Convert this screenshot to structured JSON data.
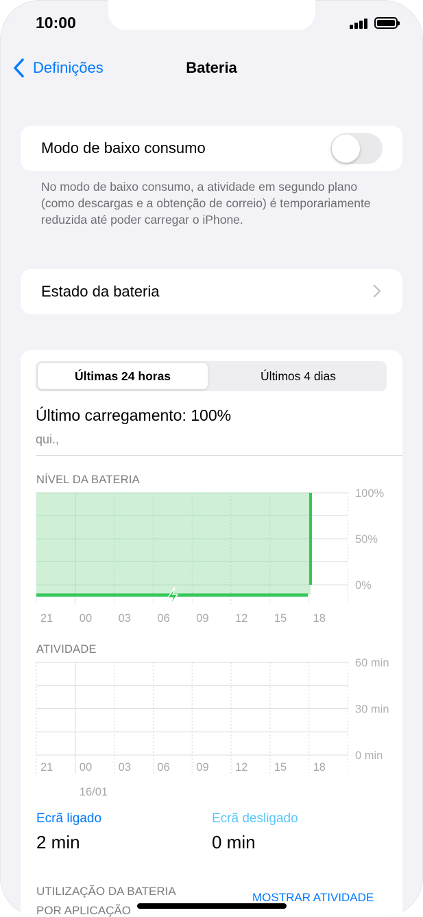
{
  "status_bar": {
    "time": "10:00"
  },
  "nav": {
    "back_label": "Definições",
    "title": "Bateria"
  },
  "low_power": {
    "label": "Modo de baixo consumo",
    "enabled": false,
    "footnote": "No modo de baixo consumo, a atividade em segundo plano (como descargas e a obtenção de correio) é temporariamente reduzida até poder carregar o iPhone."
  },
  "battery_health": {
    "label": "Estado da bateria"
  },
  "tabs": [
    {
      "label": "Últimas 24 horas",
      "active": true
    },
    {
      "label": "Últimos 4 dias",
      "active": false
    }
  ],
  "last_charge": {
    "title": "Último carregamento: 100%",
    "date": "qui.,"
  },
  "colors": {
    "accent": "#007aff",
    "green": "#34c759",
    "green_fill": "#cdeed5",
    "screen_off": "#5ac8fa"
  },
  "chart_data": [
    {
      "type": "area",
      "title": "NÍVEL DA BATERIA",
      "x": [
        "21",
        "00",
        "03",
        "06",
        "09",
        "12",
        "15",
        "18"
      ],
      "y_ticks": [
        "100%",
        "50%",
        "0%"
      ],
      "ylim": [
        0,
        100
      ],
      "level_percent": [
        100,
        100,
        100,
        100,
        100,
        100,
        100,
        100
      ],
      "charging_indicator": true
    },
    {
      "type": "bar",
      "title": "ATIVIDADE",
      "x": [
        "21",
        "00",
        "03",
        "06",
        "09",
        "12",
        "15",
        "18"
      ],
      "x_sublabel": "16/01",
      "y_ticks": [
        "60 min",
        "30 min",
        "0 min"
      ],
      "ylim": [
        0,
        60
      ],
      "values": [
        0,
        0,
        0,
        0,
        0,
        0,
        0,
        0
      ]
    }
  ],
  "screen_stats": {
    "on": {
      "label": "Ecrã ligado",
      "value": "2 min"
    },
    "off": {
      "label": "Ecrã desligado",
      "value": "0 min"
    }
  },
  "app_usage": {
    "label_line1": "UTILIZAÇÃO DA BATERIA",
    "label_line2": "POR APLICAÇÃO",
    "show_activity": "MOSTRAR ATIVIDADE"
  }
}
